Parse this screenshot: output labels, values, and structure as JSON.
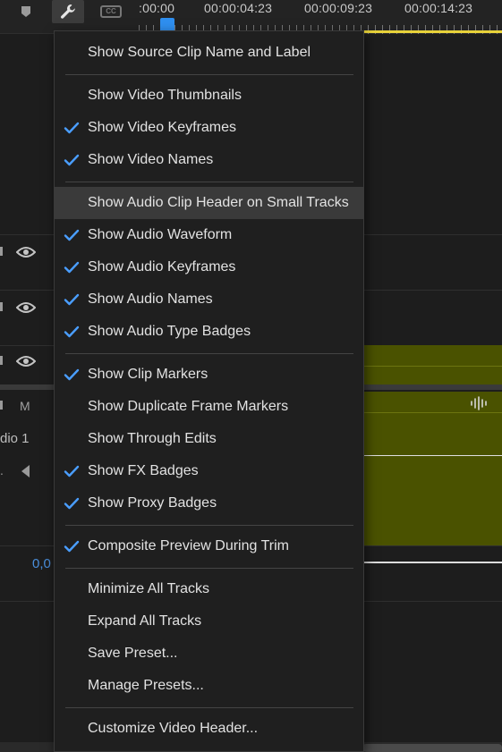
{
  "toolbar": {
    "icons": [
      "marker-icon",
      "wrench-icon",
      "closed-caption-icon"
    ],
    "cc_label": "CC"
  },
  "ruler": {
    "timecodes": [
      ":00:00",
      "00:00:04:23",
      "00:00:09:23",
      "00:00:14:23"
    ]
  },
  "tracks": {
    "mute_label": "M",
    "audio_name": "dio 1",
    "dot_label": ".",
    "volume_value": "0,0"
  },
  "colors": {
    "checkmark": "#4a9eff",
    "clip": "#4a5200",
    "playhead": "#2f8ff0",
    "work_area": "#e8d23a"
  },
  "menu": {
    "items": [
      {
        "label": "Show Source Clip Name and Label",
        "checked": false
      },
      {
        "label": "Show Video Thumbnails",
        "checked": false
      },
      {
        "label": "Show Video Keyframes",
        "checked": true
      },
      {
        "label": "Show Video Names",
        "checked": true
      },
      {
        "label": "Show Audio Clip Header on Small Tracks",
        "checked": false,
        "highlighted": true
      },
      {
        "label": "Show Audio Waveform",
        "checked": true
      },
      {
        "label": "Show Audio Keyframes",
        "checked": true
      },
      {
        "label": "Show Audio Names",
        "checked": true
      },
      {
        "label": "Show Audio Type Badges",
        "checked": true
      },
      {
        "label": "Show Clip Markers",
        "checked": true
      },
      {
        "label": "Show Duplicate Frame Markers",
        "checked": false
      },
      {
        "label": "Show Through Edits",
        "checked": false
      },
      {
        "label": "Show FX Badges",
        "checked": true
      },
      {
        "label": "Show Proxy Badges",
        "checked": true
      },
      {
        "label": "Composite Preview During Trim",
        "checked": true
      },
      {
        "label": "Minimize All Tracks",
        "checked": false
      },
      {
        "label": "Expand All Tracks",
        "checked": false
      },
      {
        "label": "Save Preset...",
        "checked": false
      },
      {
        "label": "Manage Presets...",
        "checked": false
      },
      {
        "label": "Customize Video Header...",
        "checked": false
      }
    ]
  }
}
